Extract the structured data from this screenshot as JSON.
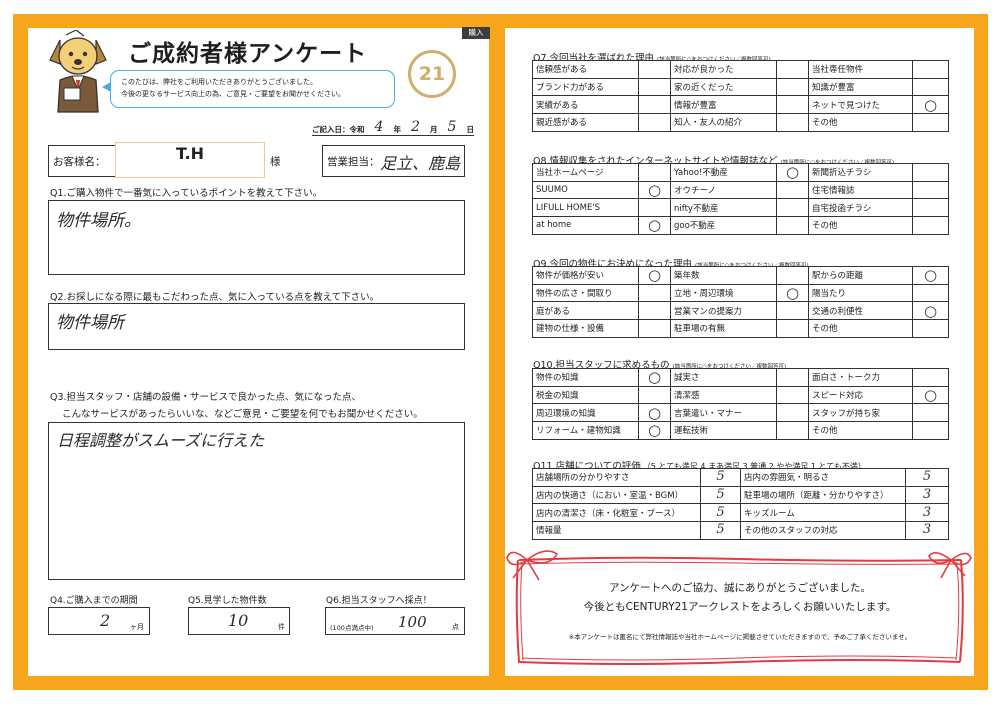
{
  "left": {
    "tab_label": "購入",
    "title": "ご成約者様アンケート",
    "greeting": {
      "line1": "このたびは、弊社をご利用いただきありがとうございました。",
      "line2": "今後の更なるサービス向上の為、ご意見・ご要望をお聞かせください。"
    },
    "logo_text": "21",
    "date": {
      "label": "ご記入日：令和",
      "year": "4",
      "year_unit": "年",
      "month": "2",
      "month_unit": "月",
      "day": "5",
      "day_unit": "日"
    },
    "customer": {
      "label": "お客様名：",
      "value": "T.H",
      "suffix": "様"
    },
    "staff": {
      "label": "営業担当：",
      "value": "足立、鹿島"
    },
    "q1": {
      "question": "Q1.ご購入物件で一番気に入っているポイントを教えて下さい。",
      "answer": "物件場所。"
    },
    "q2": {
      "question": "Q2.お探しになる際に最もこだわった点、気に入っている点を教えて下さい。",
      "answer": "物件場所"
    },
    "q3": {
      "question_line1": "Q3.担当スタッフ・店舗の設備・サービスで良かった点、気になった点、",
      "question_line2": "こんなサービスがあったらいいな、などご意見・ご要望を何でもお聞かせください。",
      "answer": "日程調整がスムーズに行えた"
    },
    "q4": {
      "question": "Q4.ご購入までの期間",
      "answer": "2",
      "unit": "ヶ月"
    },
    "q5": {
      "question": "Q5.見学した物件数",
      "answer": "10",
      "unit": "件"
    },
    "q6": {
      "question": "Q6.担当スタッフへ採点！",
      "note": "(100点満点中)",
      "answer": "100",
      "unit": "点"
    }
  },
  "right": {
    "q7": {
      "title": "Q7.今回当社を選ばれた理由",
      "note": "(該当箇所に○をおつけください／複数回答可)",
      "rows": [
        [
          {
            "label": "信頼感がある",
            "mark": ""
          },
          {
            "label": "対応が良かった",
            "mark": ""
          },
          {
            "label": "当社専任物件",
            "mark": ""
          }
        ],
        [
          {
            "label": "ブランド力がある",
            "mark": ""
          },
          {
            "label": "家の近くだった",
            "mark": ""
          },
          {
            "label": "知識が豊富",
            "mark": ""
          }
        ],
        [
          {
            "label": "実績がある",
            "mark": ""
          },
          {
            "label": "情報が豊富",
            "mark": ""
          },
          {
            "label": "ネットで見つけた",
            "mark": "○"
          }
        ],
        [
          {
            "label": "親近感がある",
            "mark": ""
          },
          {
            "label": "知人・友人の紹介",
            "mark": ""
          },
          {
            "label": "その他",
            "mark": ""
          }
        ]
      ]
    },
    "q8": {
      "title": "Q8.情報収集をされたインターネットサイトや情報誌など",
      "note": "(該当箇所に○をおつけください／複数回答可)",
      "rows": [
        [
          {
            "label": "当社ホームページ",
            "mark": ""
          },
          {
            "label": "Yahoo!不動産",
            "mark": "○"
          },
          {
            "label": "新聞折込チラシ",
            "mark": ""
          }
        ],
        [
          {
            "label": "SUUMO",
            "mark": "○"
          },
          {
            "label": "オウチーノ",
            "mark": ""
          },
          {
            "label": "住宅情報誌",
            "mark": ""
          }
        ],
        [
          {
            "label": "LIFULL HOME'S",
            "mark": ""
          },
          {
            "label": "nifty不動産",
            "mark": ""
          },
          {
            "label": "自宅投函チラシ",
            "mark": ""
          }
        ],
        [
          {
            "label": "at home",
            "mark": "○"
          },
          {
            "label": "goo不動産",
            "mark": ""
          },
          {
            "label": "その他",
            "mark": ""
          }
        ]
      ]
    },
    "q9": {
      "title": "Q9.今回の物件にお決めになった理由",
      "note": "(該当箇所に○をおつけください／複数回答可)",
      "rows": [
        [
          {
            "label": "物件が価格が安い",
            "mark": "○"
          },
          {
            "label": "築年数",
            "mark": ""
          },
          {
            "label": "駅からの距離",
            "mark": "○"
          }
        ],
        [
          {
            "label": "物件の広さ・間取り",
            "mark": ""
          },
          {
            "label": "立地・周辺環境",
            "mark": "○"
          },
          {
            "label": "陽当たり",
            "mark": ""
          }
        ],
        [
          {
            "label": "庭がある",
            "mark": ""
          },
          {
            "label": "営業マンの提案力",
            "mark": ""
          },
          {
            "label": "交通の利便性",
            "mark": "○"
          }
        ],
        [
          {
            "label": "建物の仕様・設備",
            "mark": ""
          },
          {
            "label": "駐車場の有無",
            "mark": ""
          },
          {
            "label": "その他",
            "mark": ""
          }
        ]
      ]
    },
    "q10": {
      "title": "Q10.担当スタッフに求めるもの",
      "note": "(該当箇所に○をおつけください／複数回答可)",
      "rows": [
        [
          {
            "label": "物件の知識",
            "mark": "○"
          },
          {
            "label": "誠実さ",
            "mark": ""
          },
          {
            "label": "面白さ・トーク力",
            "mark": ""
          }
        ],
        [
          {
            "label": "税金の知識",
            "mark": ""
          },
          {
            "label": "清潔感",
            "mark": ""
          },
          {
            "label": "スピード対応",
            "mark": "○"
          }
        ],
        [
          {
            "label": "周辺環境の知識",
            "mark": "○"
          },
          {
            "label": "言葉遣い・マナー",
            "mark": ""
          },
          {
            "label": "スタッフが持ち家",
            "mark": ""
          }
        ],
        [
          {
            "label": "リフォーム・建物知識",
            "mark": "○"
          },
          {
            "label": "運転技術",
            "mark": ""
          },
          {
            "label": "その他",
            "mark": ""
          }
        ]
      ]
    },
    "q11": {
      "title": "Q11.店舗についての評価",
      "scale": "（5.とても満足  4.まあ満足  3.普通  2.やや満足  1.とても不満）",
      "rows": [
        [
          {
            "label": "店舗場所の分かりやすさ",
            "score": "5"
          },
          {
            "label": "店内の雰囲気・明るさ",
            "score": "5"
          }
        ],
        [
          {
            "label": "店内の快適さ（におい・室温・BGM）",
            "score": "5"
          },
          {
            "label": "駐車場の場所（距離・分かりやすさ）",
            "score": "3"
          }
        ],
        [
          {
            "label": "店内の清潔さ（床・化粧室・ブース）",
            "score": "5"
          },
          {
            "label": "キッズルーム",
            "score": "3"
          }
        ],
        [
          {
            "label": "情報量",
            "score": "5"
          },
          {
            "label": "その他のスタッフの対応",
            "score": "3"
          }
        ]
      ]
    },
    "closing": {
      "line1": "アンケートへのご協力、誠にありがとうございました。",
      "line2": "今後ともCENTURY21アークレストをよろしくお願いいたします。",
      "note": "※本アンケートは匿名にて弊社情報誌や当社ホームページに掲載させていただきますので、予めご了承くださいませ。"
    }
  },
  "icons": {
    "mascot": "dog-mascot-icon",
    "logo": "century21-logo",
    "ribbon": "ribbon-frame"
  },
  "colors": {
    "frame": "#f7a51c",
    "ribbon": "#e53a40",
    "bubble": "#4fa9dd",
    "logo": "#cfae6e",
    "tab": "#3d3d3d"
  }
}
